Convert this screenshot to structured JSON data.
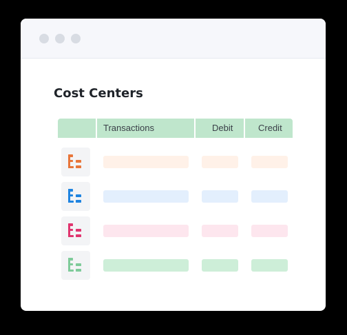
{
  "page_title": "Cost Centers",
  "window_controls": [
    "window-dot",
    "window-dot",
    "window-dot"
  ],
  "table": {
    "columns": [
      "",
      "Transactions",
      "Debit",
      "Credit"
    ],
    "rows": [
      {
        "icon": "hierarchy-icon",
        "color": "#e8763a",
        "placeholder": "#fff1e8"
      },
      {
        "icon": "hierarchy-icon",
        "color": "#1f84e0",
        "placeholder": "#e3effd"
      },
      {
        "icon": "hierarchy-icon",
        "color": "#e0356f",
        "placeholder": "#fde6ee"
      },
      {
        "icon": "hierarchy-icon",
        "color": "#7fcb9a",
        "placeholder": "#cdeed8"
      }
    ]
  },
  "colors": {
    "header_bg": "#bfe6cc",
    "titlebar_bg": "#f6f7fb",
    "dot": "#d8dce3"
  }
}
